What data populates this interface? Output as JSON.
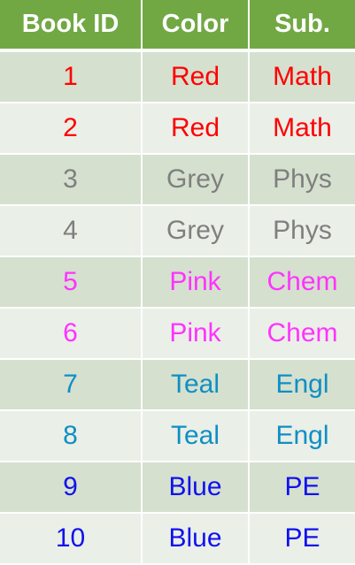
{
  "table": {
    "headers": [
      "Book ID",
      "Color",
      "Sub."
    ],
    "rows": [
      {
        "id": "1",
        "color": "Red",
        "subject": "Math",
        "text_color": "#ff0000"
      },
      {
        "id": "2",
        "color": "Red",
        "subject": "Math",
        "text_color": "#ff0000"
      },
      {
        "id": "3",
        "color": "Grey",
        "subject": "Phys",
        "text_color": "#7f7f7f"
      },
      {
        "id": "4",
        "color": "Grey",
        "subject": "Phys",
        "text_color": "#7f7f7f"
      },
      {
        "id": "5",
        "color": "Pink",
        "subject": "Chem",
        "text_color": "#ff33ff"
      },
      {
        "id": "6",
        "color": "Pink",
        "subject": "Chem",
        "text_color": "#ff33ff"
      },
      {
        "id": "7",
        "color": "Teal",
        "subject": "Engl",
        "text_color": "#0f8fc4"
      },
      {
        "id": "8",
        "color": "Teal",
        "subject": "Engl",
        "text_color": "#0f8fc4"
      },
      {
        "id": "9",
        "color": "Blue",
        "subject": "PE",
        "text_color": "#1111ee"
      },
      {
        "id": "10",
        "color": "Blue",
        "subject": "PE",
        "text_color": "#1111ee"
      }
    ]
  },
  "colors": {
    "header_bg": "#71a844",
    "header_text": "#ffffff",
    "row_odd_bg": "#d5e0cf",
    "row_even_bg": "#eaefe8"
  }
}
